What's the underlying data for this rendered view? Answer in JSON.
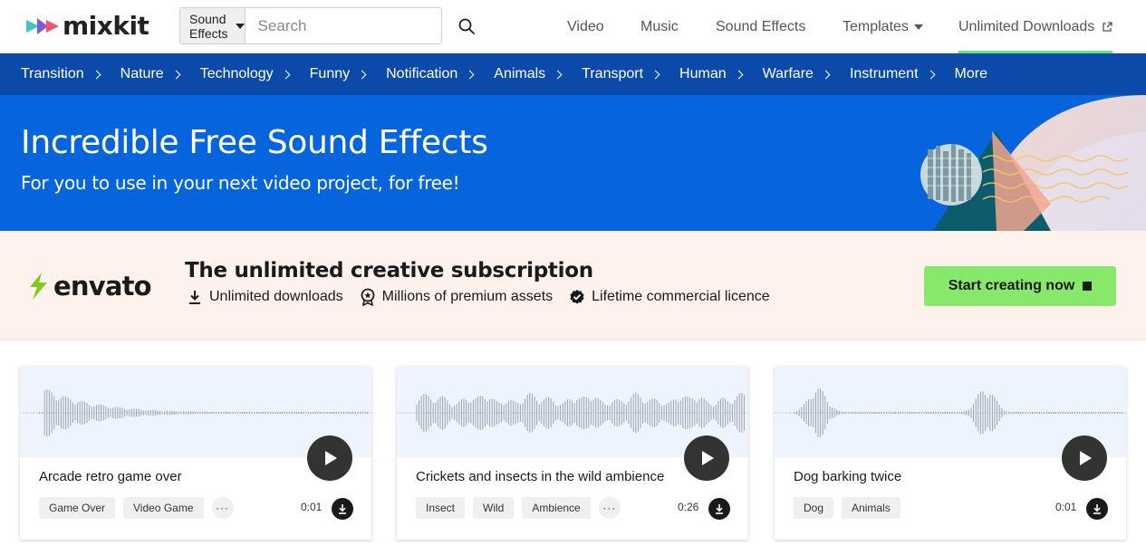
{
  "header": {
    "logo_text": "mixkit",
    "search": {
      "category": "Sound Effects",
      "placeholder": "Search"
    },
    "nav": [
      {
        "label": "Video"
      },
      {
        "label": "Music"
      },
      {
        "label": "Sound Effects"
      },
      {
        "label": "Templates"
      },
      {
        "label": "Unlimited Downloads"
      }
    ]
  },
  "categories": [
    "Transition",
    "Nature",
    "Technology",
    "Funny",
    "Notification",
    "Animals",
    "Transport",
    "Human",
    "Warfare",
    "Instrument",
    "More"
  ],
  "hero": {
    "title": "Incredible Free Sound Effects",
    "subtitle": "For you to use in your next video project, for free!"
  },
  "promo": {
    "brand": "envato",
    "title": "The unlimited creative subscription",
    "features": [
      "Unlimited downloads",
      "Millions of premium assets",
      "Lifetime commercial licence"
    ],
    "cta": "Start creating now"
  },
  "cards": [
    {
      "title": "Arcade retro game over",
      "tags": [
        "Game Over",
        "Video Game"
      ],
      "more": "···",
      "duration": "0:01"
    },
    {
      "title": "Crickets and insects in the wild ambience",
      "tags": [
        "Insect",
        "Wild",
        "Ambience"
      ],
      "more": "···",
      "duration": "0:26"
    },
    {
      "title": "Dog barking twice",
      "tags": [
        "Dog",
        "Animals"
      ],
      "duration": "0:01"
    }
  ],
  "colors": {
    "category_bar": "#0b4aa8",
    "hero_bg": "#0665dd",
    "promo_bg": "#fdf2ec",
    "cta_bg": "#87e86c",
    "waveform_bg": "#eef4fe",
    "nav_active_underline": "#6ee07a"
  }
}
